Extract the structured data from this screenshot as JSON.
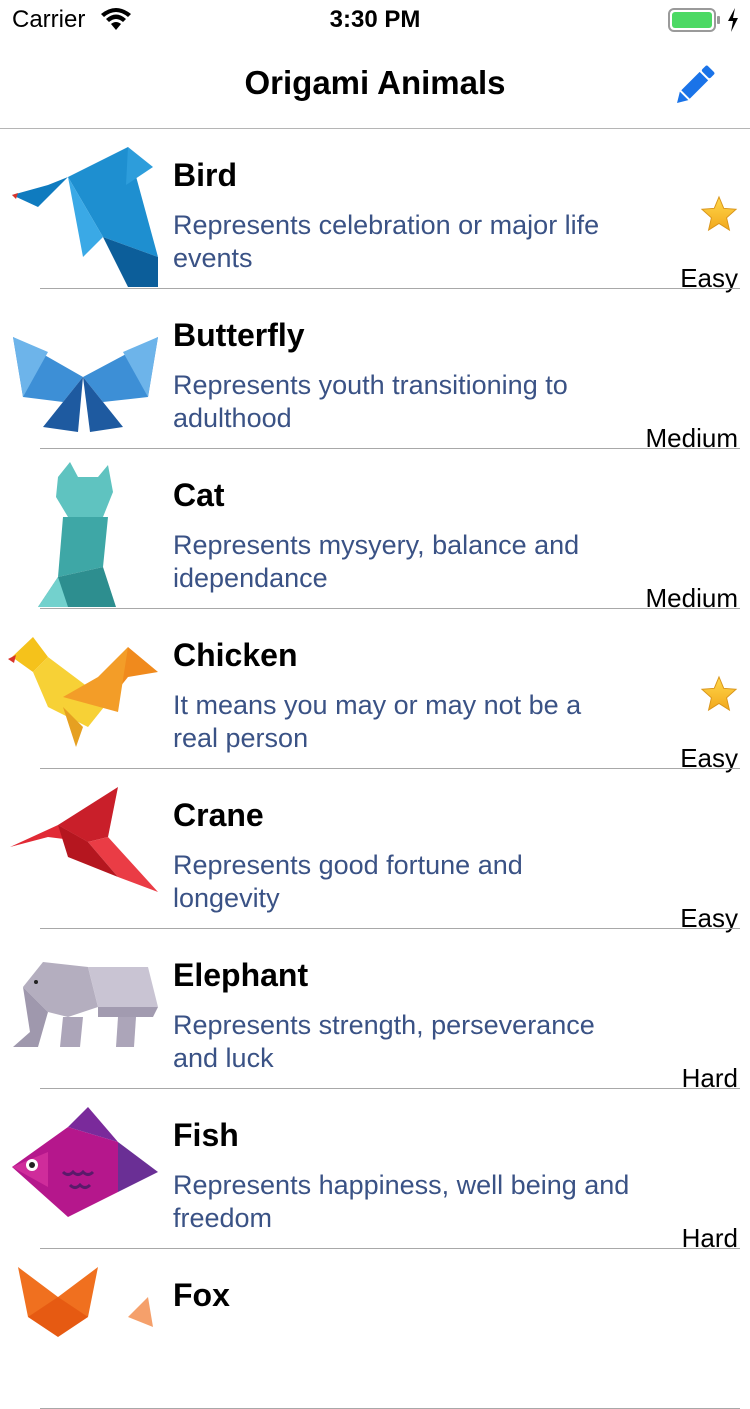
{
  "status_bar": {
    "carrier": "Carrier",
    "time": "3:30 PM",
    "battery_color": "#4cd964"
  },
  "nav": {
    "title": "Origami Animals",
    "edit_icon": "pencil-icon",
    "accent": "#1a73e8"
  },
  "items": [
    {
      "name": "Bird",
      "description": "Represents celebration or major life events",
      "difficulty": "Easy",
      "starred": true,
      "image": "origami-bird"
    },
    {
      "name": "Butterfly",
      "description": "Represents youth transitioning to adulthood",
      "difficulty": "Medium",
      "starred": false,
      "image": "origami-butterfly"
    },
    {
      "name": "Cat",
      "description": "Represents mysyery, balance and idependance",
      "difficulty": "Medium",
      "starred": false,
      "image": "origami-cat"
    },
    {
      "name": "Chicken",
      "description": "It means you may or may not be a real person",
      "difficulty": "Easy",
      "starred": true,
      "image": "origami-chicken"
    },
    {
      "name": "Crane",
      "description": "Represents good fortune and longevity",
      "difficulty": "Easy",
      "starred": false,
      "image": "origami-crane"
    },
    {
      "name": "Elephant",
      "description": "Represents strength, perseverance and luck",
      "difficulty": "Hard",
      "starred": false,
      "image": "origami-elephant"
    },
    {
      "name": "Fish",
      "description": "Represents happiness, well being and freedom",
      "difficulty": "Hard",
      "starred": false,
      "image": "origami-fish"
    },
    {
      "name": "Fox",
      "description": "",
      "difficulty": "",
      "starred": false,
      "image": "origami-fox"
    }
  ]
}
